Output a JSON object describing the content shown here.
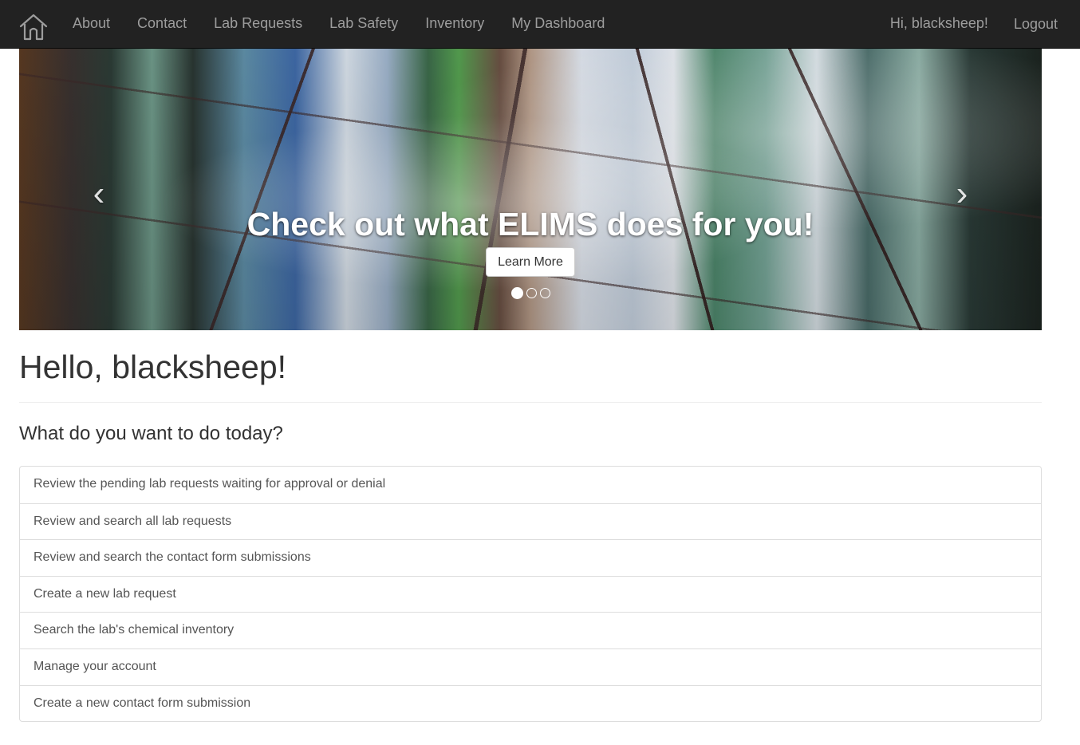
{
  "navbar": {
    "home_icon": "home-icon",
    "links": [
      {
        "label": "About"
      },
      {
        "label": "Contact"
      },
      {
        "label": "Lab Requests"
      },
      {
        "label": "Lab Safety"
      },
      {
        "label": "Inventory"
      },
      {
        "label": "My Dashboard"
      }
    ],
    "greeting": "Hi, blacksheep!",
    "logout_label": "Logout"
  },
  "carousel": {
    "prev_icon": "‹",
    "next_icon": "›",
    "caption_title": "Check out what ELIMS does for you!",
    "button_label": "Learn More",
    "slide_count": 3,
    "active_slide": 1
  },
  "main": {
    "title": "Hello, blacksheep!",
    "subtitle": "What do you want to do today?",
    "actions": [
      {
        "label": "Review the pending lab requests waiting for approval or denial"
      },
      {
        "label": "Review and search all lab requests"
      },
      {
        "label": "Review and search the contact form submissions"
      },
      {
        "label": "Create a new lab request"
      },
      {
        "label": "Search the lab's chemical inventory"
      },
      {
        "label": "Manage your account"
      },
      {
        "label": "Create a new contact form submission"
      }
    ]
  },
  "colors": {
    "navbar_bg": "#222222",
    "nav_text": "#9d9d9d",
    "list_border": "#dddddd",
    "list_text": "#555555"
  }
}
